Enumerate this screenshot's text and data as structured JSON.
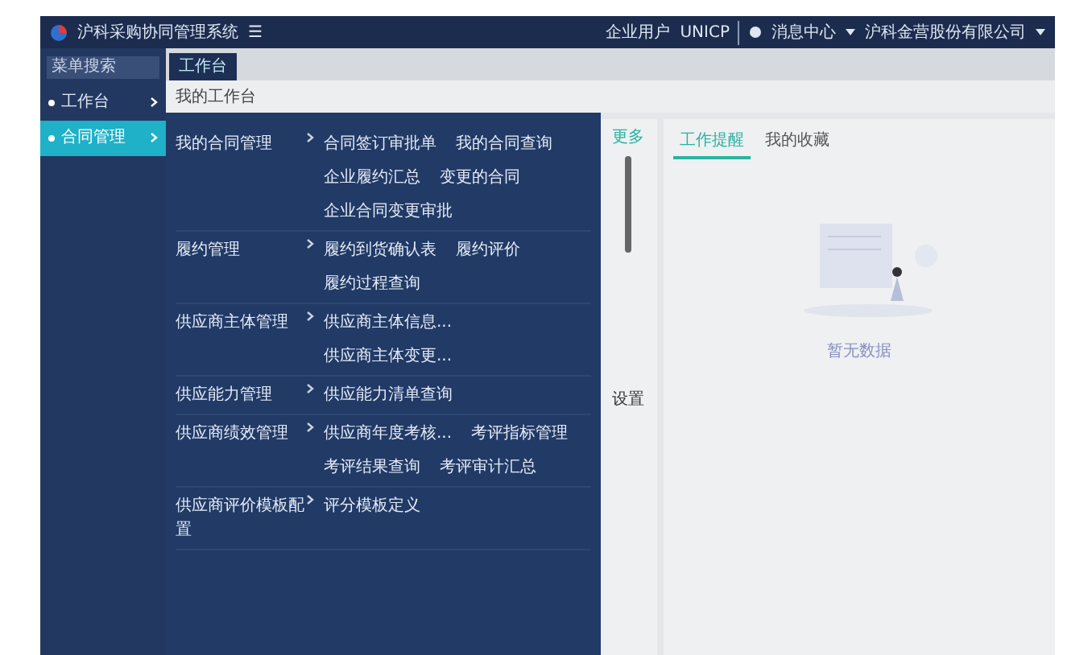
{
  "header": {
    "title": "沪科采购协同管理系统",
    "menu_toggle": "☰",
    "links": [
      "企业用户",
      "UNICP"
    ],
    "message_center": "消息中心",
    "company": "沪科金营股份有限公司"
  },
  "sidebar": {
    "search": {
      "placeholder": "菜单搜索"
    },
    "items": [
      {
        "label": "工作台",
        "selected": false
      },
      {
        "label": "合同管理",
        "selected": true
      }
    ]
  },
  "tabs": [
    {
      "label": "工作台",
      "selected": true
    }
  ],
  "page_title": "我的工作台",
  "mega_menu": [
    {
      "title": "我的合同管理",
      "items": [
        "合同签订审批单",
        "我的合同查询",
        "企业履约汇总",
        "变更的合同",
        "企业合同变更审批"
      ]
    },
    {
      "title": "履约管理",
      "items": [
        "履约到货确认表",
        "履约评价",
        "履约过程查询"
      ]
    },
    {
      "title": "供应商主体管理",
      "items": [
        "供应商主体信息...",
        "供应商主体变更..."
      ]
    },
    {
      "title": "供应能力管理",
      "items": [
        "供应能力清单查询"
      ]
    },
    {
      "title": "供应商绩效管理",
      "items": [
        "供应商年度考核...",
        "考评指标管理",
        "考评结果查询",
        "考评审计汇总"
      ]
    },
    {
      "title": "供应商评价模板配置",
      "items": [
        "评分模板定义"
      ]
    }
  ],
  "middle_card": {
    "more": "更多",
    "setting": "设置"
  },
  "right_panel": {
    "tabs": [
      {
        "label": "工作提醒",
        "selected": true
      },
      {
        "label": "我的收藏",
        "selected": false
      }
    ],
    "empty_text": "暂无数据"
  }
}
